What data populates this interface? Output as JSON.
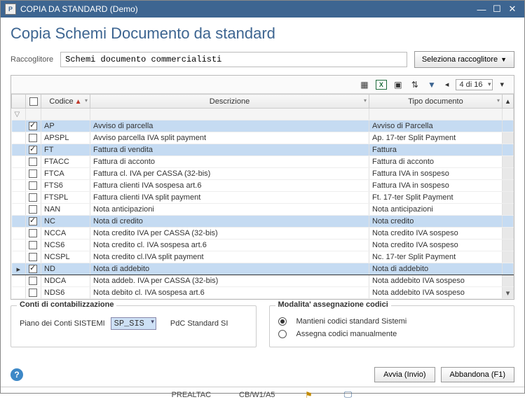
{
  "window": {
    "title": "COPIA DA STANDARD  (Demo)"
  },
  "page_title": "Copia Schemi Documento da standard",
  "raccoglitore": {
    "label": "Raccoglitore",
    "value": "Schemi documento commercialisti",
    "select_button": "Seleziona raccoglitore"
  },
  "pager": {
    "text": "4 di 16"
  },
  "columns": {
    "codice": "Codice",
    "descrizione": "Descrizione",
    "tipo": "Tipo documento"
  },
  "rows": [
    {
      "checked": true,
      "codice": "AP",
      "descrizione": "Avviso di parcella",
      "tipo": "Avviso di Parcella",
      "sel": true
    },
    {
      "checked": false,
      "codice": "APSPL",
      "descrizione": "Avviso parcella IVA split payment",
      "tipo": "Ap. 17-ter Split Payment",
      "sel": false
    },
    {
      "checked": true,
      "codice": "FT",
      "descrizione": "Fattura di vendita",
      "tipo": "Fattura",
      "sel": true
    },
    {
      "checked": false,
      "codice": "FTACC",
      "descrizione": "Fattura di acconto",
      "tipo": "Fattura di acconto",
      "sel": false
    },
    {
      "checked": false,
      "codice": "FTCA",
      "descrizione": "Fattura cl. IVA per CASSA (32-bis)",
      "tipo": "Fattura IVA in sospeso",
      "sel": false
    },
    {
      "checked": false,
      "codice": "FTS6",
      "descrizione": "Fattura clienti IVA sospesa art.6",
      "tipo": "Fattura IVA in sospeso",
      "sel": false
    },
    {
      "checked": false,
      "codice": "FTSPL",
      "descrizione": "Fattura clienti IVA split payment",
      "tipo": "Ft. 17-ter Split Payment",
      "sel": false
    },
    {
      "checked": false,
      "codice": "NAN",
      "descrizione": "Nota anticipazioni",
      "tipo": "Nota anticipazioni",
      "sel": false
    },
    {
      "checked": true,
      "codice": "NC",
      "descrizione": "Nota di credito",
      "tipo": "Nota credito",
      "sel": true
    },
    {
      "checked": false,
      "codice": "NCCA",
      "descrizione": "Nota credito IVA per CASSA (32-bis)",
      "tipo": "Nota credito IVA sospeso",
      "sel": false
    },
    {
      "checked": false,
      "codice": "NCS6",
      "descrizione": "Nota credito cl. IVA sospesa art.6",
      "tipo": "Nota credito IVA sospeso",
      "sel": false
    },
    {
      "checked": false,
      "codice": "NCSPL",
      "descrizione": "Nota credito cl.IVA split payment",
      "tipo": "Nc. 17-ter Split Payment",
      "sel": false
    },
    {
      "checked": true,
      "codice": "ND",
      "descrizione": "Nota di addebito",
      "tipo": "Nota di addebito",
      "sel": true,
      "current": true
    },
    {
      "checked": false,
      "codice": "NDCA",
      "descrizione": "Nota addeb. IVA per CASSA (32-bis)",
      "tipo": "Nota addebito IVA sospeso",
      "sel": false
    },
    {
      "checked": false,
      "codice": "NDS6",
      "descrizione": "Nota debito cl. IVA sospesa art.6",
      "tipo": "Nota addebito IVA sospeso",
      "sel": false
    }
  ],
  "conti": {
    "legend": "Conti di contabilizzazione",
    "label": "Piano dei Conti SISTEMI",
    "value": "SP_SIS",
    "standard_label": "PdC Standard SI"
  },
  "modalita": {
    "legend": "Modalita' assegnazione codici",
    "opt1": "Mantieni codici standard Sistemi",
    "opt2": "Assegna codici manualmente"
  },
  "buttons": {
    "avvia": "Avvia (Invio)",
    "abbandona": "Abbandona (F1)"
  },
  "status": {
    "user": "PREALTAC",
    "code": "CB/W1/A5"
  }
}
